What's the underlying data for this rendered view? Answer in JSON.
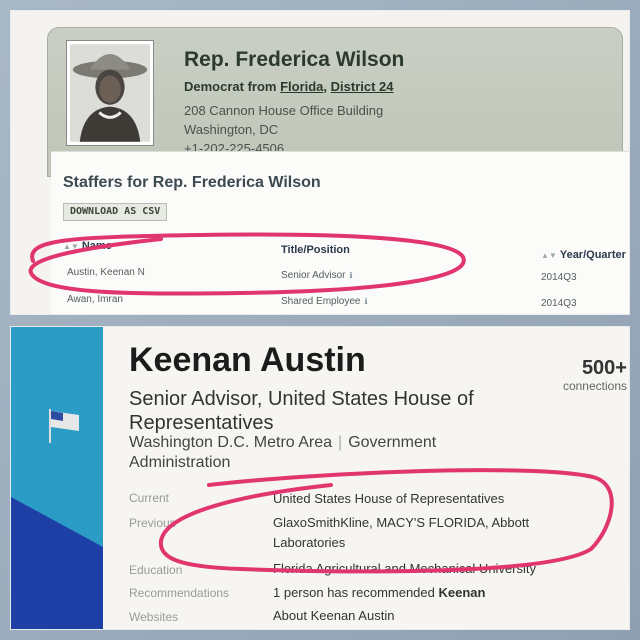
{
  "rep": {
    "name": "Rep. Frederica Wilson",
    "party_prefix": "Democrat from ",
    "state": "Florida",
    "district_sep": ", ",
    "district": "District 24",
    "address_line1": "208 Cannon House Office Building",
    "address_line2": "Washington, DC",
    "phone": "+1-202-225-4506"
  },
  "staffers": {
    "title": "Staffers for Rep. Frederica Wilson",
    "download_label": "DOWNLOAD AS CSV",
    "columns": [
      "Name",
      "Title/Position",
      "Year/Quarter"
    ],
    "rows": [
      {
        "name": "Austin, Keenan N",
        "title": "Senior Advisor",
        "year": "2014Q3"
      },
      {
        "name": "Awan, Imran",
        "title": "Shared Employee",
        "year": "2014Q3"
      }
    ]
  },
  "profile": {
    "name": "Keenan Austin",
    "headline": "Senior Advisor, United States House of Representatives",
    "location": "Washington D.C. Metro Area",
    "industry": "Government Administration",
    "connections_count": "500+",
    "connections_label": "connections",
    "fields": [
      {
        "label": "Current",
        "value": "United States House of Representatives"
      },
      {
        "label": "Previous",
        "value": "GlaxoSmithKline, MACY'S FLORIDA, Abbott Laboratories"
      },
      {
        "label": "Education",
        "value": "Florida Agricultural and Mechanical University"
      },
      {
        "label": "Recommendations",
        "value_prefix": "1 person has recommended ",
        "value_bold": "Keenan"
      },
      {
        "label": "Websites",
        "value": "About Keenan Austin"
      }
    ]
  },
  "colors": {
    "highlight_circle": "#e0356f",
    "profile_accent": "#2a9cc6",
    "rep_card": "#c9cfc4"
  }
}
